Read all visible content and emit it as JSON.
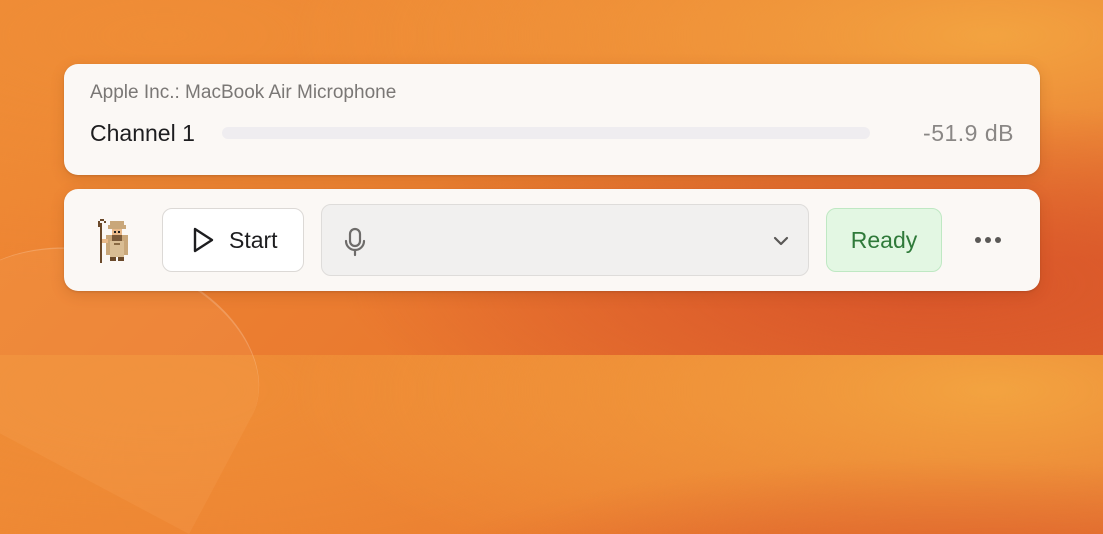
{
  "meter": {
    "device_name": "Apple Inc.: MacBook Air Microphone",
    "channel_label": "Channel 1",
    "level_fraction": 0.0,
    "level_db": "-51.9 dB"
  },
  "controls": {
    "start_label": "Start",
    "device_select_value": "",
    "status": "Ready",
    "status_color": "#2f7a3a",
    "mascot_icon": "pixel-shepherd-mascot",
    "play_icon": "play-icon",
    "mic_icon": "microphone-icon",
    "chevron_icon": "chevron-down-icon",
    "more_icon": "ellipsis-icon"
  }
}
